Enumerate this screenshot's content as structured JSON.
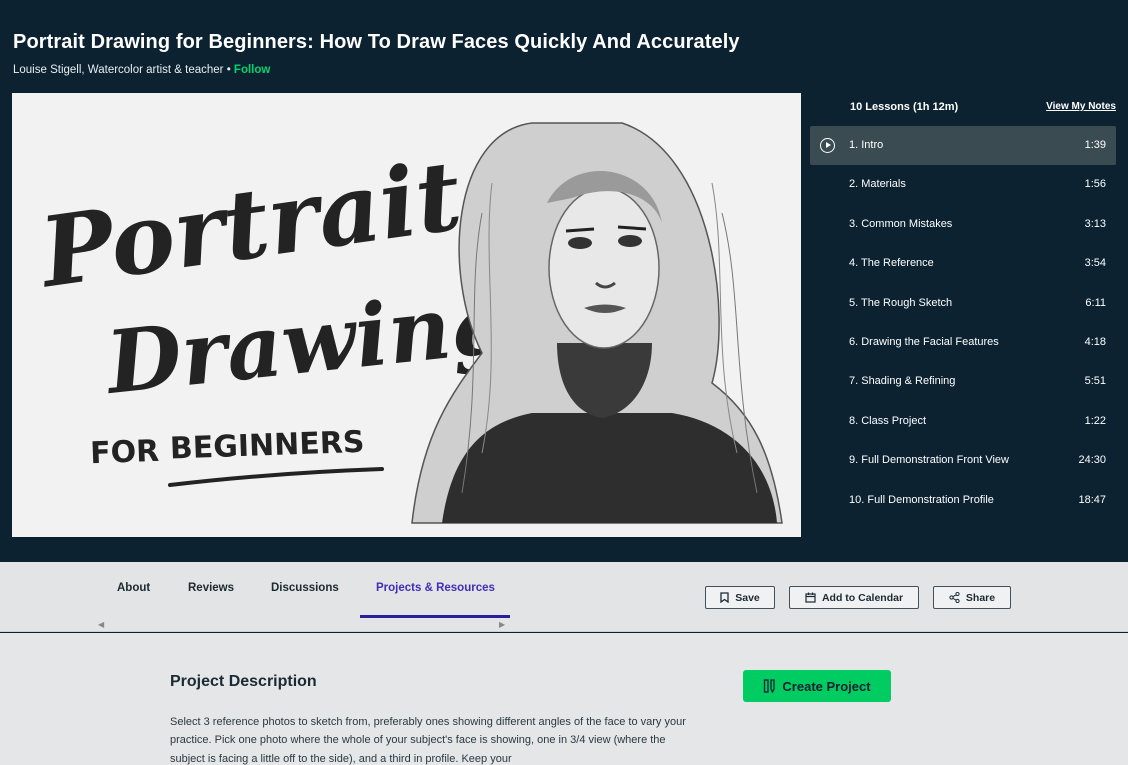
{
  "header": {
    "title": "Portrait Drawing for Beginners: How To Draw Faces Quickly And Accurately",
    "teacher": "Louise Stigell, Watercolor artist & teacher",
    "separator": " • ",
    "follow_label": "Follow"
  },
  "video": {
    "thumbnail_text": [
      "Portrait",
      "Drawing",
      "FOR",
      "BEGINNERS"
    ]
  },
  "playlist": {
    "header": "10 Lessons (1h 12m)",
    "notes_link": "View My Notes",
    "lessons": [
      {
        "title": "1. Intro",
        "duration": "1:39"
      },
      {
        "title": "2. Materials",
        "duration": "1:56"
      },
      {
        "title": "3. Common Mistakes",
        "duration": "3:13"
      },
      {
        "title": "4. The Reference",
        "duration": "3:54"
      },
      {
        "title": "5. The Rough Sketch",
        "duration": "6:11"
      },
      {
        "title": "6. Drawing the Facial Features",
        "duration": "4:18"
      },
      {
        "title": "7. Shading & Refining",
        "duration": "5:51"
      },
      {
        "title": "8. Class Project",
        "duration": "1:22"
      },
      {
        "title": "9. Full Demonstration Front View",
        "duration": "24:30"
      },
      {
        "title": "10. Full Demonstration Profile",
        "duration": "18:47"
      }
    ]
  },
  "tabs": {
    "items": [
      {
        "label": "About"
      },
      {
        "label": "Reviews"
      },
      {
        "label": "Discussions"
      },
      {
        "label": "Projects & Resources"
      }
    ],
    "active": "Projects & Resources"
  },
  "actions": {
    "save_label": "Save",
    "calendar_label": "Add to Calendar",
    "share_label": "Share"
  },
  "project": {
    "title": "Project Description",
    "create_label": "Create Project",
    "description": "Select 3 reference photos to sketch from, preferably ones showing different angles of the face to vary your practice. Pick one photo where the whole of your subject's face is showing, one in 3/4 view (where the subject is facing a little off to the side), and a third in profile. Keep your"
  },
  "colors": {
    "background": "#0c2231",
    "accent_green": "#00cc62",
    "active_tab": "#3d2fb8"
  }
}
